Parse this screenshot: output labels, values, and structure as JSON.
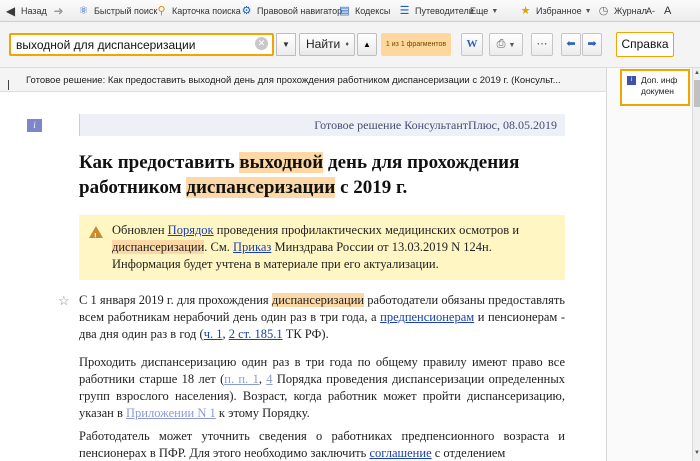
{
  "toolbar": {
    "back": "Назад",
    "quick_search": "Быстрый поиск",
    "search_card": "Карточка поиска",
    "legal_navigator": "Правовой навигатор",
    "codes": "Кодексы",
    "guides": "Путеводители",
    "more": "Еще",
    "favorites": "Избранное",
    "journal": "Журнал",
    "font_size": "A-",
    "font_size_up": "A"
  },
  "search": {
    "query": "выходной для диспансеризации",
    "find_label": "Найти",
    "found_text": "1 из 1 фрагментов"
  },
  "tools": {
    "word_label": "W",
    "help_label": "Справка"
  },
  "document": {
    "strip_title": "Готовое решение: Как предоставить выходной день для прохождения работником диспансеризации с 2019 г. (Консульт...",
    "meta": "Готовое решение КонсультантПлюс, 08.05.2019",
    "title": {
      "p1": "Как предоставить ",
      "h1": "выходной",
      "p2": " день для прохождения работником ",
      "h2": "диспансеризации",
      "p3": " с 2019 г."
    },
    "notice": {
      "t1": "Обновлен ",
      "link1": "Порядок",
      "t2": " проведения профилактических медицинских осмотров и ",
      "hl": "диспансеризации",
      "t3": ". См. ",
      "link2": "Приказ",
      "t4": " Минздрава России от 13.03.2019 N 124н. Информация будет учтена в материале при его актуализации."
    },
    "para1": {
      "t1": "С 1 января 2019 г. для прохождения ",
      "hl": "диспансеризации",
      "t2": " работодатели обязаны предоставлять всем работникам нерабочий день один раз в три года, а ",
      "link1": "предпенсионерам",
      "t3": " и пенсионерам - два дня один раз в год (",
      "link2": "ч. 1",
      "t4": ", ",
      "link3": "2 ст. 185.1",
      "t5": " ТК РФ)."
    },
    "para2": {
      "t1": "Проходить диспансеризацию один раз в три года по общему правилу имеют право все работники старше 18 лет (",
      "link1": "п. п. 1",
      "t2": ", ",
      "link2": "4",
      "t3": " Порядка проведения диспансеризации определенных групп взрослого населения). Возраст, когда работник может пройти диспансеризацию, указан в ",
      "link3": "Приложении N 1",
      "t4": " к этому Порядку."
    },
    "para3": {
      "t1": "Работодатель может уточнить сведения о работниках предпенсионного возраста и пенсионерах в ПФР. Для этого необходимо заключить ",
      "link1": "соглашение",
      "t2": " с отделением"
    }
  },
  "right_panel": {
    "card_line1": "Доп. инф",
    "card_line2": "докумен"
  },
  "colors": {
    "accent": "#f0a500",
    "highlight": "#fbd8a6",
    "link": "#1a3fae",
    "notice_bg": "#fff6c4"
  }
}
